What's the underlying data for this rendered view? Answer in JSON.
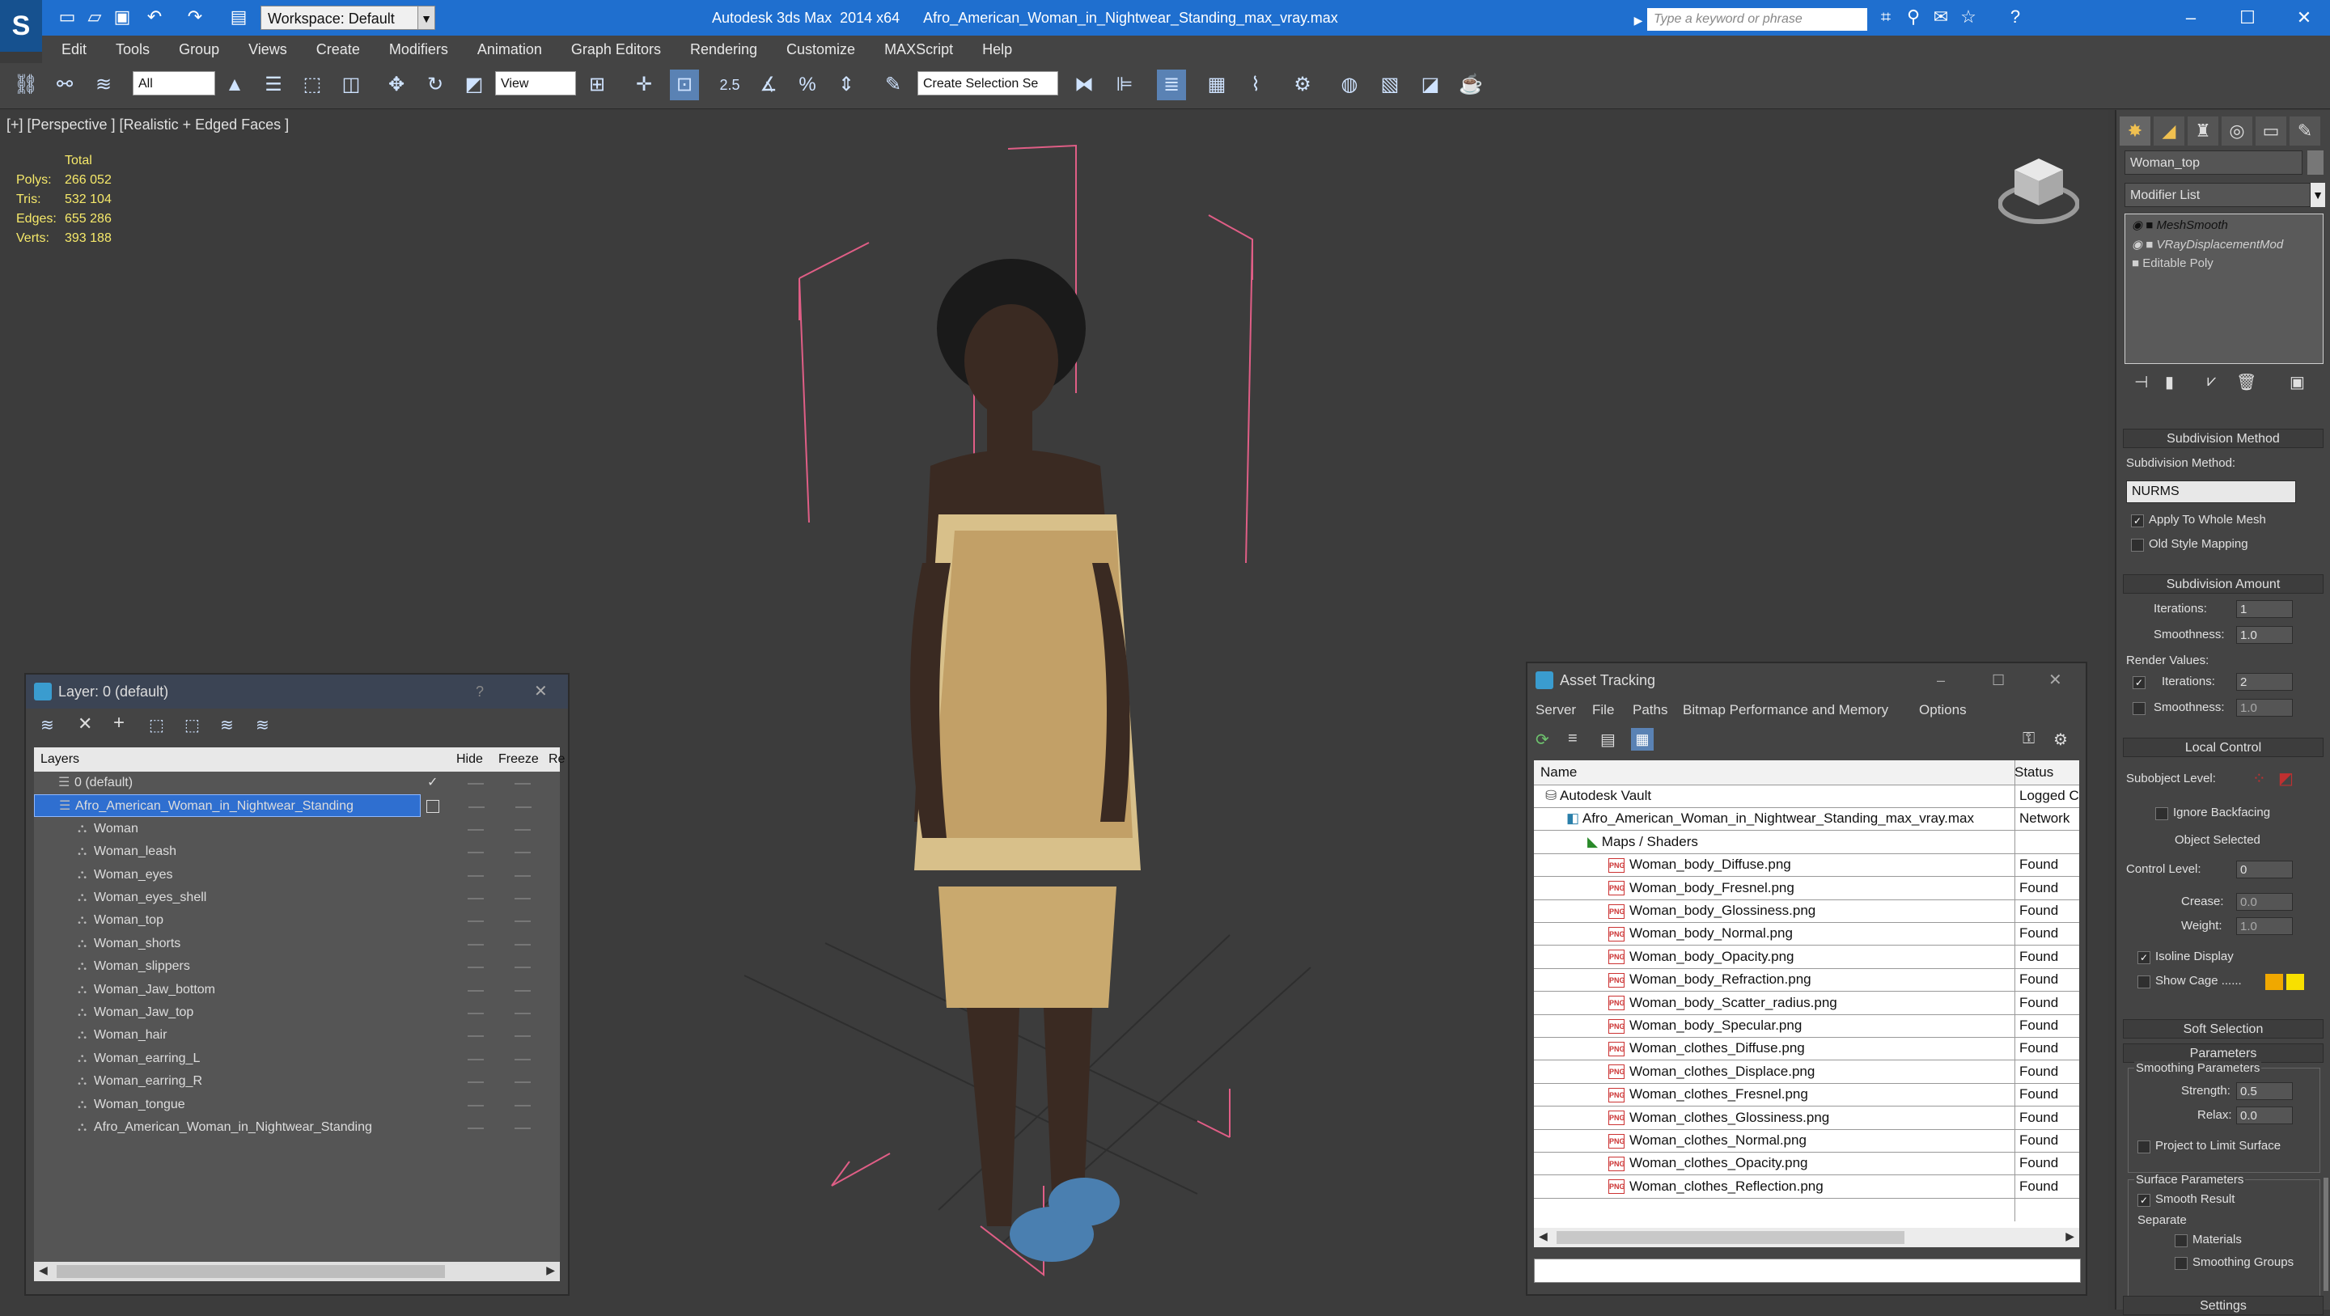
{
  "titlebar": {
    "workspace": "Workspace: Default",
    "app_name": "Autodesk 3ds Max  2014 x64",
    "file_name": "Afro_American_Woman_in_Nightwear_Standing_max_vray.max",
    "search_placeholder": "Type a keyword or phrase"
  },
  "menubar": [
    "Edit",
    "Tools",
    "Group",
    "Views",
    "Create",
    "Modifiers",
    "Animation",
    "Graph Editors",
    "Rendering",
    "Customize",
    "MAXScript",
    "Help"
  ],
  "toolbar": {
    "filter": "All",
    "ref_coord": "View",
    "selection_set": "Create Selection Se",
    "snap_label": "2.5",
    "percent_label": "%"
  },
  "viewport": {
    "label": "[+] [Perspective ] [Realistic + Edged Faces ]",
    "stats_header": "Total",
    "stats": [
      {
        "label": "Polys:",
        "value": "266 052"
      },
      {
        "label": "Tris:",
        "value": "532 104"
      },
      {
        "label": "Edges:",
        "value": "655 286"
      },
      {
        "label": "Verts:",
        "value": "393 188"
      }
    ]
  },
  "cmdpanel": {
    "object_name": "Woman_top",
    "modifier_list": "Modifier List",
    "stack": [
      "MeshSmooth",
      "VRayDisplacementMod",
      "Editable Poly"
    ],
    "subdivision_method": {
      "title": "Subdivision Method",
      "method_label": "Subdivision Method:",
      "method_value": "NURMS",
      "apply_whole_mesh": "Apply To Whole Mesh",
      "old_style_mapping": "Old Style Mapping"
    },
    "subdivision_amount": {
      "title": "Subdivision Amount",
      "iterations_label": "Iterations:",
      "iterations_value": "1",
      "smoothness_label": "Smoothness:",
      "smoothness_value": "1.0",
      "render_values": "Render Values:",
      "render_iterations_label": "Iterations:",
      "render_iterations_value": "2",
      "render_smoothness_label": "Smoothness:",
      "render_smoothness_value": "1.0"
    },
    "local_control": {
      "title": "Local Control",
      "subobject_level": "Subobject Level:",
      "ignore_backfacing": "Ignore Backfacing",
      "object_selected": "Object Selected",
      "control_level_label": "Control Level:",
      "control_level_value": "0",
      "crease_label": "Crease:",
      "crease_value": "0.0",
      "weight_label": "Weight:",
      "weight_value": "1.0",
      "isoline_display": "Isoline Display",
      "show_cage": "Show Cage ......"
    },
    "soft_selection": "Soft Selection",
    "parameters": {
      "title": "Parameters",
      "smoothing_params": "Smoothing Parameters",
      "strength_label": "Strength:",
      "strength_value": "0.5",
      "relax_label": "Relax:",
      "relax_value": "0.0",
      "project_limit": "Project to Limit Surface",
      "surface_params": "Surface Parameters",
      "smooth_result": "Smooth Result",
      "separate": "Separate",
      "materials": "Materials",
      "smoothing_groups": "Smoothing Groups"
    },
    "settings": "Settings",
    "cage_colors": [
      "#f0a800",
      "#f8e000"
    ]
  },
  "layer_window": {
    "title": "Layer: 0 (default)",
    "help": "?",
    "columns": [
      "Layers",
      "Hide",
      "Freeze",
      "Re"
    ],
    "rows": [
      {
        "name": "0 (default)",
        "indent": 0
      },
      {
        "name": "Afro_American_Woman_in_Nightwear_Standing",
        "indent": 0
      },
      {
        "name": "Woman",
        "indent": 1
      },
      {
        "name": "Woman_leash",
        "indent": 1
      },
      {
        "name": "Woman_eyes",
        "indent": 1
      },
      {
        "name": "Woman_eyes_shell",
        "indent": 1
      },
      {
        "name": "Woman_top",
        "indent": 1
      },
      {
        "name": "Woman_shorts",
        "indent": 1
      },
      {
        "name": "Woman_slippers",
        "indent": 1
      },
      {
        "name": "Woman_Jaw_bottom",
        "indent": 1
      },
      {
        "name": "Woman_Jaw_top",
        "indent": 1
      },
      {
        "name": "Woman_hair",
        "indent": 1
      },
      {
        "name": "Woman_earring_L",
        "indent": 1
      },
      {
        "name": "Woman_earring_R",
        "indent": 1
      },
      {
        "name": "Woman_tongue",
        "indent": 1
      },
      {
        "name": "Afro_American_Woman_in_Nightwear_Standing",
        "indent": 1
      }
    ]
  },
  "asset_window": {
    "title": "Asset Tracking",
    "menus": [
      "Server",
      "File",
      "Paths",
      "Bitmap Performance and Memory",
      "Options"
    ],
    "columns": [
      "Name",
      "Status"
    ],
    "rows": [
      {
        "name": "Autodesk Vault",
        "status": "Logged C",
        "indent": 1,
        "kind": "vault"
      },
      {
        "name": "Afro_American_Woman_in_Nightwear_Standing_max_vray.max",
        "status": "Network",
        "indent": 2,
        "kind": "file"
      },
      {
        "name": "Maps / Shaders",
        "status": "",
        "indent": 3,
        "kind": "folder"
      },
      {
        "name": "Woman_body_Diffuse.png",
        "status": "Found",
        "indent": 4,
        "kind": "png"
      },
      {
        "name": "Woman_body_Fresnel.png",
        "status": "Found",
        "indent": 4,
        "kind": "png"
      },
      {
        "name": "Woman_body_Glossiness.png",
        "status": "Found",
        "indent": 4,
        "kind": "png"
      },
      {
        "name": "Woman_body_Normal.png",
        "status": "Found",
        "indent": 4,
        "kind": "png"
      },
      {
        "name": "Woman_body_Opacity.png",
        "status": "Found",
        "indent": 4,
        "kind": "png"
      },
      {
        "name": "Woman_body_Refraction.png",
        "status": "Found",
        "indent": 4,
        "kind": "png"
      },
      {
        "name": "Woman_body_Scatter_radius.png",
        "status": "Found",
        "indent": 4,
        "kind": "png"
      },
      {
        "name": "Woman_body_Specular.png",
        "status": "Found",
        "indent": 4,
        "kind": "png"
      },
      {
        "name": "Woman_clothes_Diffuse.png",
        "status": "Found",
        "indent": 4,
        "kind": "png"
      },
      {
        "name": "Woman_clothes_Displace.png",
        "status": "Found",
        "indent": 4,
        "kind": "png"
      },
      {
        "name": "Woman_clothes_Fresnel.png",
        "status": "Found",
        "indent": 4,
        "kind": "png"
      },
      {
        "name": "Woman_clothes_Glossiness.png",
        "status": "Found",
        "indent": 4,
        "kind": "png"
      },
      {
        "name": "Woman_clothes_Normal.png",
        "status": "Found",
        "indent": 4,
        "kind": "png"
      },
      {
        "name": "Woman_clothes_Opacity.png",
        "status": "Found",
        "indent": 4,
        "kind": "png"
      },
      {
        "name": "Woman_clothes_Reflection.png",
        "status": "Found",
        "indent": 4,
        "kind": "png"
      }
    ]
  }
}
